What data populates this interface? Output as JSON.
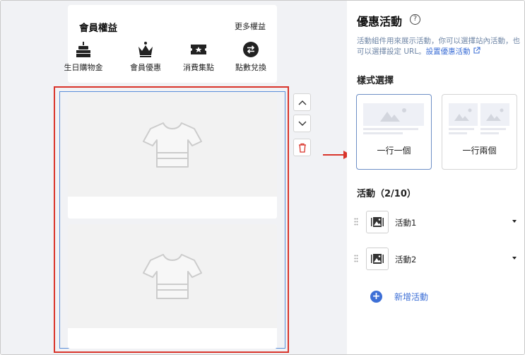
{
  "member": {
    "title": "會員權益",
    "more": "更多權益",
    "benefits": [
      {
        "label": "生日購物金",
        "icon": "cake-icon"
      },
      {
        "label": "會員優惠",
        "icon": "crown-icon"
      },
      {
        "label": "消費集點",
        "icon": "ticket-star-icon"
      },
      {
        "label": "點數兌換",
        "icon": "exchange-icon"
      }
    ]
  },
  "panel": {
    "title": "優惠活動",
    "desc": "活動組件用來展示活動，你可以選擇站內活動，也可以選擇設定 URL。",
    "desc_link": "設置優惠活動",
    "style_section": "樣式選擇",
    "styles": [
      {
        "label": "一行一個",
        "selected": true
      },
      {
        "label": "一行兩個",
        "selected": false
      }
    ],
    "activities_section": "活動（2/10）",
    "activities": [
      {
        "label": "活動1"
      },
      {
        "label": "活動2"
      }
    ],
    "add_label": "新增活動"
  },
  "colors": {
    "accent": "#3d6fd6",
    "highlight": "#d9342b",
    "selection": "#5b8fd9"
  }
}
